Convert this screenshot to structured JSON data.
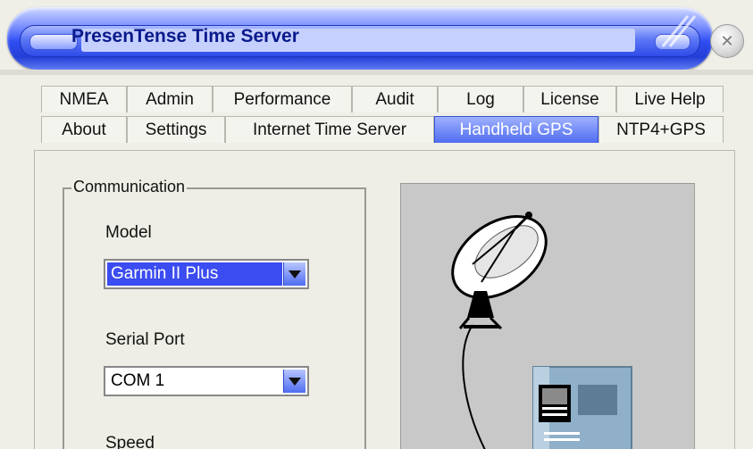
{
  "window": {
    "title": "PresenTense Time Server",
    "close_icon": "close-icon"
  },
  "tabs": {
    "row1": [
      {
        "label": "NMEA"
      },
      {
        "label": "Admin"
      },
      {
        "label": "Performance"
      },
      {
        "label": "Audit"
      },
      {
        "label": "Log"
      },
      {
        "label": "License"
      },
      {
        "label": "Live Help"
      }
    ],
    "row2": [
      {
        "label": "About"
      },
      {
        "label": "Settings"
      },
      {
        "label": "Internet Time Server"
      },
      {
        "label": "Handheld GPS",
        "active": true
      },
      {
        "label": "NTP4+GPS"
      }
    ]
  },
  "communication": {
    "legend": "Communication",
    "model_label": "Model",
    "model_value": "Garmin II Plus",
    "serial_port_label": "Serial Port",
    "serial_port_value": "COM 1",
    "speed_label": "Speed"
  },
  "colors": {
    "accent": "#3b4cf0",
    "title_text": "#0a1a8c"
  }
}
